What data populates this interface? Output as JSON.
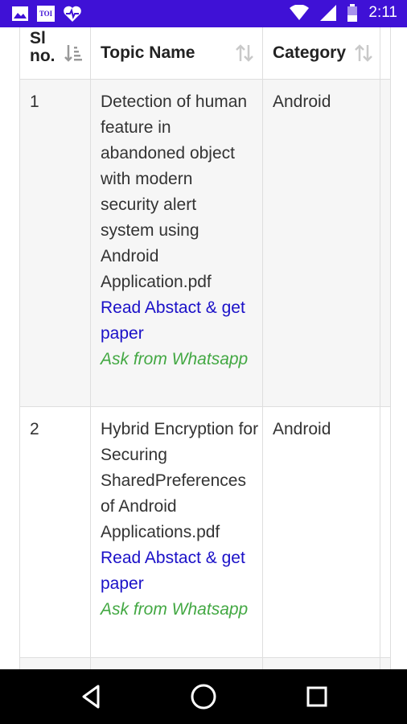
{
  "status_bar": {
    "time": "2:11",
    "left_icons": [
      "image-icon",
      "toi-icon",
      "heart-pulse-icon"
    ],
    "toi_label": "TOI",
    "right_icons": [
      "wifi-icon",
      "signal-icon",
      "battery-icon"
    ]
  },
  "table": {
    "headers": {
      "slno_line1": "Sl",
      "slno_line2": "no.",
      "topic": "Topic Name",
      "category": "Category"
    },
    "rows": [
      {
        "slno": "1",
        "topic": "Detection of human feature in abandoned object with modern security alert system using Android Application.pdf",
        "read_link": "Read Abstact & get paper",
        "whatsapp_link": "Ask from Whatsapp",
        "category": "Android"
      },
      {
        "slno": "2",
        "topic": "Hybrid Encryption for Securing SharedPreferences of Android Applications.pdf",
        "read_link": "Read Abstact & get paper",
        "whatsapp_link": "Ask from Whatsapp",
        "category": "Android"
      }
    ]
  },
  "colors": {
    "status_bar": "#3f11d6",
    "link_blue": "#1a10c8",
    "link_green": "#43a843",
    "nav_bar": "#000000"
  },
  "nav_bar": {
    "icons": [
      "back-icon",
      "home-icon",
      "recents-icon"
    ]
  }
}
